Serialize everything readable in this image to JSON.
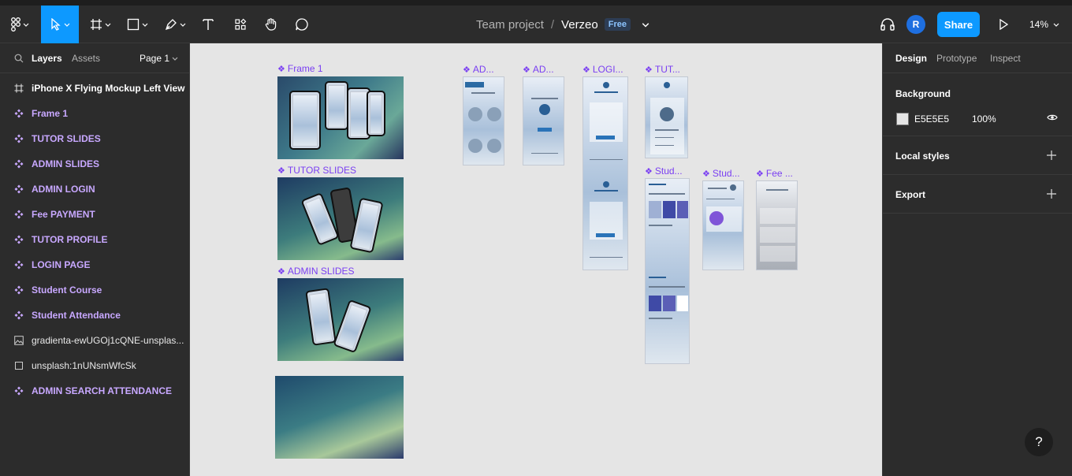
{
  "toolbar": {
    "file_team": "Team project",
    "file_name": "Verzeo",
    "plan_badge": "Free",
    "avatar_initial": "R",
    "share_label": "Share",
    "zoom_level": "14%",
    "icons": [
      "figma-menu-icon",
      "move-tool-icon",
      "frame-tool-icon",
      "shape-tool-icon",
      "pen-tool-icon",
      "text-tool-icon",
      "resources-icon",
      "hand-tool-icon",
      "comment-icon",
      "headphones-icon",
      "play-icon"
    ]
  },
  "left_panel": {
    "tabs": {
      "layers": "Layers",
      "assets": "Assets",
      "page": "Page 1"
    },
    "layers": [
      {
        "label": "iPhone X Flying Mockup Left View",
        "kind": "frame"
      },
      {
        "label": "Frame 1",
        "kind": "component"
      },
      {
        "label": "TUTOR SLIDES",
        "kind": "component"
      },
      {
        "label": "ADMIN SLIDES",
        "kind": "component"
      },
      {
        "label": "ADMIN LOGIN",
        "kind": "component"
      },
      {
        "label": "Fee PAYMENT",
        "kind": "component"
      },
      {
        "label": "TUTOR PROFILE",
        "kind": "component"
      },
      {
        "label": "LOGIN PAGE",
        "kind": "component"
      },
      {
        "label": "Student Course",
        "kind": "component"
      },
      {
        "label": "Student Attendance",
        "kind": "component"
      },
      {
        "label": "gradienta-ewUGOj1cQNE-unsplas...",
        "kind": "image"
      },
      {
        "label": "unsplash:1nUNsmWfcSk",
        "kind": "rectangle"
      },
      {
        "label": "ADMIN SEARCH ATTENDANCE",
        "kind": "component"
      }
    ]
  },
  "canvas": {
    "background_color": "#E5E5E5",
    "frame_labels": {
      "frame1": "Frame 1",
      "tutor_slides": "TUTOR SLIDES",
      "admin_slides": "ADMIN SLIDES",
      "ad1": "AD...",
      "ad2": "AD...",
      "login": "LOGI...",
      "tutor": "TUT...",
      "stud1": "Stud...",
      "stud2": "Stud...",
      "fee": "Fee ..."
    }
  },
  "right_panel": {
    "tabs": {
      "design": "Design",
      "prototype": "Prototype",
      "inspect": "Inspect"
    },
    "background": {
      "title": "Background",
      "hex": "E5E5E5",
      "opacity": "100%"
    },
    "local_styles": "Local styles",
    "export": "Export"
  },
  "help_label": "?"
}
